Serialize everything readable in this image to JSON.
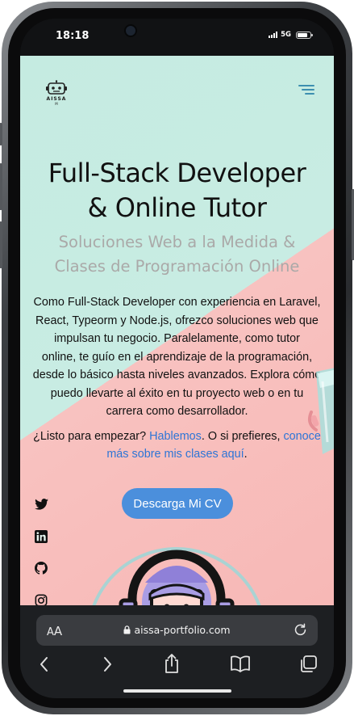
{
  "status_bar": {
    "time": "18:18",
    "network": "5G",
    "battery_level": 0.85
  },
  "site": {
    "logo_text": "AISSA",
    "logo_sub": "M",
    "headline_line1": "Full-Stack Developer",
    "headline_line2": "& Online Tutor",
    "subtitle_line1": "Soluciones Web a la Medida &",
    "subtitle_line2": "Clases de Programación Online",
    "intro_line1": "Como Full-Stack Developer con experiencia en Laravel,",
    "intro_line2": "React, Typeorm y Node.js, ofrezco soluciones web que",
    "intro_line3": "impulsan tu negocio. Paralelamente, como tutor",
    "intro_line4": "online, te guío en el aprendizaje de la programación,",
    "intro_line5": "desde lo básico hasta niveles avanzados. Explora cómo",
    "intro_line6": "puedo llevarte al éxito en tu proyecto web o en tu",
    "intro_line7": "carrera como desarrollador.",
    "cta_prefix": "¿Listo para empezar? ",
    "cta_link1": "Hablemos",
    "cta_middle": ". O si prefieres, ",
    "cta_link2_part1": "conoce",
    "cta_link2_part2": "más sobre mis clases aquí",
    "cta_end": ".",
    "download_button": "Descarga Mi CV",
    "social_icons": [
      "twitter-icon",
      "linkedin-icon",
      "github-icon",
      "instagram-icon"
    ],
    "colors": {
      "accent_blue": "#4b8fdc",
      "link_blue": "#2e75d6",
      "mint_background": "#c5ebe1",
      "pink_background": "#f8c2c0",
      "avatar_purple": "#a99de4"
    }
  },
  "browser": {
    "text_size_label_small": "A",
    "text_size_label_big": "A",
    "url": "aissa-portfolio.com",
    "nav_icons": [
      "back-icon",
      "forward-icon",
      "share-icon",
      "bookmarks-icon",
      "tabs-icon"
    ]
  }
}
